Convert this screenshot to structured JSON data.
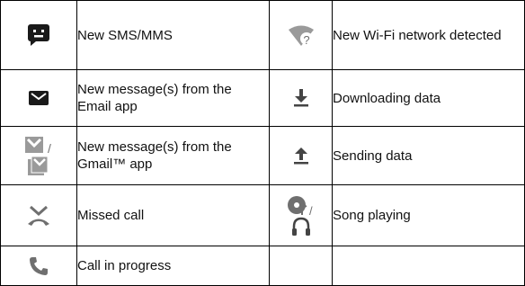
{
  "rows": [
    {
      "left": {
        "icon": "sms-icon",
        "label": "New SMS/MMS"
      },
      "right": {
        "icon": "wifi-question-icon",
        "label": "New Wi-Fi network detected"
      }
    },
    {
      "left": {
        "icon": "email-envelope-icon",
        "label": "New message(s) from the Email app"
      },
      "right": {
        "icon": "download-arrow-icon",
        "label": "Downloading data"
      }
    },
    {
      "left": {
        "icon": "gmail-icon",
        "label": "New message(s) from the Gmail™ app"
      },
      "right": {
        "icon": "upload-arrow-icon",
        "label": "Sending data"
      }
    },
    {
      "left": {
        "icon": "missed-call-icon",
        "label": "Missed call"
      },
      "right": {
        "icon": "music-headphones-icon",
        "label": "Song playing"
      }
    },
    {
      "left": {
        "icon": "phone-call-icon",
        "label": "Call in progress"
      },
      "right": {
        "icon": "",
        "label": ""
      }
    }
  ],
  "colors": {
    "icon_dark": "#1a1a1a",
    "icon_gray": "#6f6f6f",
    "icon_light": "#9a9a9a",
    "border": "#000000"
  }
}
